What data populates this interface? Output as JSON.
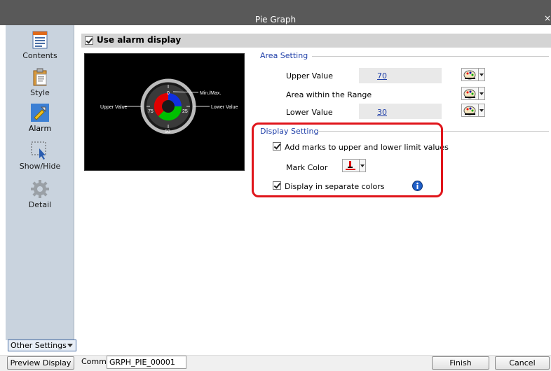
{
  "window": {
    "title": "Pie Graph",
    "close_glyph": "×"
  },
  "sidebar": {
    "items": [
      {
        "label": "Contents",
        "icon": "contents-icon"
      },
      {
        "label": "Style",
        "icon": "style-icon"
      },
      {
        "label": "Alarm",
        "icon": "alarm-icon",
        "active": true
      },
      {
        "label": "Show/Hide",
        "icon": "show-hide-icon"
      },
      {
        "label": "Detail",
        "icon": "detail-icon"
      }
    ],
    "other_settings": "Other Settings"
  },
  "main": {
    "use_alarm_display": {
      "label": "Use alarm display",
      "checked": true
    },
    "preview": {
      "labels": {
        "top": "0",
        "right": "25",
        "bottom": "50",
        "left": "75",
        "min_max": "Min./Max.",
        "upper_value": "Upper Value",
        "lower_value": "Lower Value"
      }
    },
    "area_setting": {
      "title": "Area Setting",
      "upper_value_label": "Upper Value",
      "upper_value": "70",
      "area_within_label": "Area within the Range",
      "lower_value_label": "Lower Value",
      "lower_value": "30"
    },
    "display_setting": {
      "title": "Display Setting",
      "add_marks_label": "Add marks to upper and lower limit values",
      "add_marks_checked": true,
      "mark_color_label": "Mark Color",
      "separate_colors_label": "Display in separate colors",
      "separate_colors_checked": true
    }
  },
  "bottom": {
    "preview_display": "Preview Display",
    "comm_label": "Comm",
    "comm_value": "GRPH_PIE_00001",
    "finish": "Finish",
    "cancel": "Cancel"
  },
  "colors": {
    "titlebar": "#595959",
    "sidebar_bg": "#c9d3de",
    "section_title": "#1f3fa8",
    "highlight_border": "#e0151b",
    "gauge_red": "#e00000",
    "gauge_green": "#00c000",
    "gauge_blue": "#1030e0"
  }
}
